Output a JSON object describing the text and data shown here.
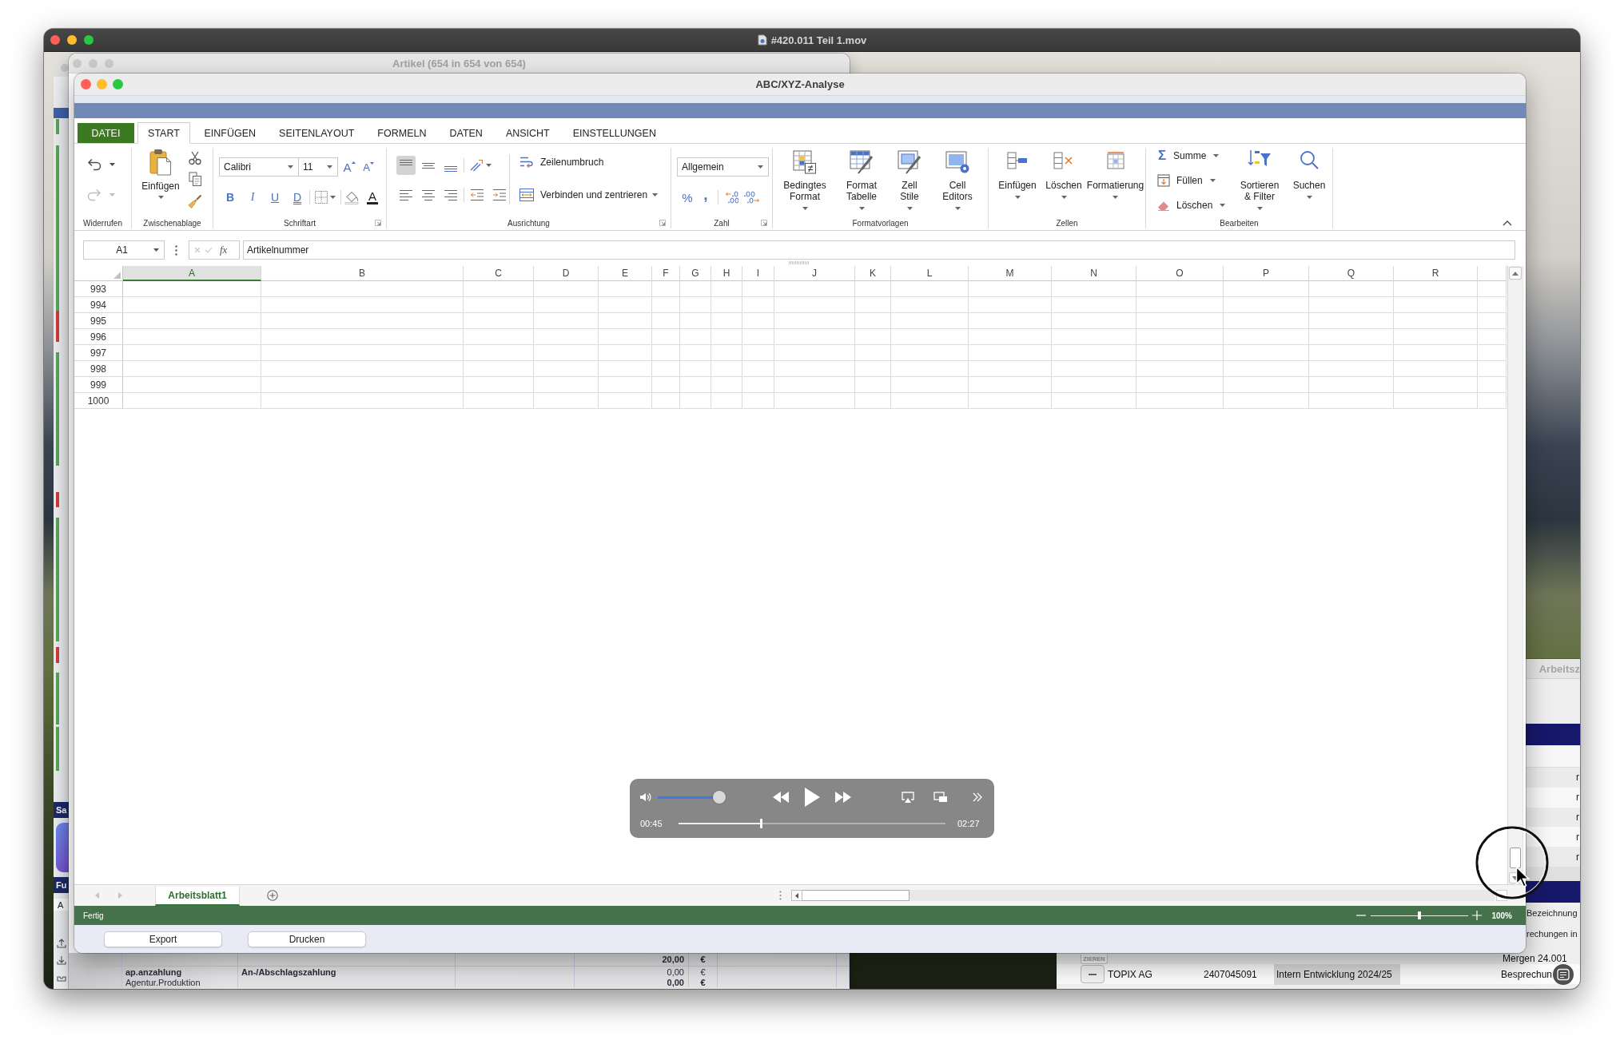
{
  "player": {
    "title": "#420.011 Teil 1.mov",
    "controls": {
      "volume": {
        "level": 1
      },
      "elapsed": "00:45",
      "progress": {
        "level": 0.31
      },
      "remaining": "02:27"
    }
  },
  "left_window": {
    "labels": [
      "Sa",
      "Fu",
      "A"
    ]
  },
  "artikel_window": {
    "title": "Artikel (654 in 654 von 654)",
    "rows": [
      {
        "column_3": {
          "text": "20,00",
          "bold": true
        },
        "column_4": {
          "text": "€",
          "bold": true
        }
      },
      {
        "column_1": {
          "text": "ap.anzahlung",
          "bold": true
        },
        "column_2": {
          "text": "An-/Abschlagszahlung",
          "bold": true
        },
        "column_3": {
          "text": "0,00",
          "bold": false
        },
        "column_4": {
          "text": "€",
          "bold": false
        }
      },
      {
        "column_1": {
          "text": "Agentur.Produktion",
          "bold": false
        },
        "column_3": {
          "text": "0,00",
          "bold": true
        },
        "column_4": {
          "text": "€",
          "bold": true
        }
      }
    ]
  },
  "right_window": {
    "title": "Arbeitsz",
    "upper_rows": [
      "r",
      "r",
      "r",
      "r",
      "r"
    ],
    "column_heading": "Bezeichnung",
    "lower_rows": [
      {
        "kind": "plain",
        "column_4": "rechungen in"
      },
      {
        "kind": "labeled",
        "button": "ZIEREN",
        "column_4": "Mergen 24.001"
      },
      {
        "kind": "remove",
        "column_1": "TOPIX AG",
        "column_2": "2407045091",
        "column_3": "Intern Entwicklung 2024/25",
        "column_4": "Besprechun"
      }
    ]
  },
  "window": {
    "title": "ABC/XYZ-Analyse",
    "tabs": [
      {
        "label": "DATEI",
        "kind": "file",
        "selected": false
      },
      {
        "label": "START",
        "kind": "tab",
        "selected": true
      },
      {
        "label": "EINFÜGEN",
        "kind": "tab",
        "selected": false
      },
      {
        "label": "SEITENLAYOUT",
        "kind": "tab",
        "selected": false
      },
      {
        "label": "FORMELN",
        "kind": "tab",
        "selected": false
      },
      {
        "label": "DATEN",
        "kind": "tab",
        "selected": false
      },
      {
        "label": "ANSICHT",
        "kind": "tab",
        "selected": false
      },
      {
        "label": "EINSTELLUNGEN",
        "kind": "tab",
        "selected": false
      }
    ],
    "ribbon": {
      "groups": [
        {
          "label": "Widerrufen",
          "buttons": [
            {
              "disabled": false
            },
            {
              "disabled": true
            }
          ]
        },
        {
          "label": "Zwischenablage",
          "paste": "Einfügen"
        },
        {
          "label": "Schriftart",
          "font": "Calibri",
          "size": "11",
          "grow": "A",
          "shrink": "A",
          "styles": [
            "B",
            "I",
            "U",
            "D"
          ],
          "font_color": "A"
        },
        {
          "label": "Ausrichtung",
          "align_buttons": [
            {
              "selected": true
            },
            {
              "selected": false
            },
            {
              "selected": false
            },
            {
              "selected": false
            },
            {
              "selected": false
            },
            {
              "selected": false
            }
          ],
          "wrap": "Zeilenumbruch",
          "merge": "Verbinden und zentrieren"
        },
        {
          "label": "Zahl",
          "format": "Allgemein",
          "percent": "%",
          "thousands": ","
        },
        {
          "label": "Formatvorlagen",
          "buttons": [
            "Bedingtes Format",
            "Format Tabelle",
            "Zell Stile",
            "Cell Editors"
          ]
        },
        {
          "label": "Zellen",
          "buttons": [
            "Einfügen",
            "Löschen",
            "Formatierung"
          ]
        },
        {
          "label": "Bearbeiten",
          "sum_symbol": "Σ",
          "small_buttons": [
            "Summe",
            "Füllen",
            "Löschen"
          ],
          "buttons": [
            "Sortieren & Filter",
            "Suchen"
          ]
        }
      ]
    },
    "formula_bar": {
      "cell": "A1",
      "fx": "fx",
      "value": "Artikelnummer"
    },
    "grid": {
      "columns": [
        {
          "label": "A",
          "selected": true
        },
        {
          "label": "B",
          "selected": false
        },
        {
          "label": "C",
          "selected": false
        },
        {
          "label": "D",
          "selected": false
        },
        {
          "label": "E",
          "selected": false
        },
        {
          "label": "F",
          "selected": false
        },
        {
          "label": "G",
          "selected": false
        },
        {
          "label": "H",
          "selected": false
        },
        {
          "label": "I",
          "selected": false
        },
        {
          "label": "J",
          "selected": false
        },
        {
          "label": "K",
          "selected": false
        },
        {
          "label": "L",
          "selected": false
        },
        {
          "label": "M",
          "selected": false
        },
        {
          "label": "N",
          "selected": false
        },
        {
          "label": "O",
          "selected": false
        },
        {
          "label": "P",
          "selected": false
        },
        {
          "label": "Q",
          "selected": false
        },
        {
          "label": "R",
          "selected": false
        }
      ],
      "rows": [
        "993",
        "994",
        "995",
        "996",
        "997",
        "998",
        "999",
        "1000"
      ]
    },
    "sheets": [
      {
        "label": "Arbeitsblatt1",
        "selected": true
      }
    ],
    "status_bar": {
      "text": "Fertig",
      "zoom": {
        "level": 0.5,
        "reading": "100%"
      }
    },
    "buttons": [
      "Export",
      "Drucken"
    ]
  }
}
